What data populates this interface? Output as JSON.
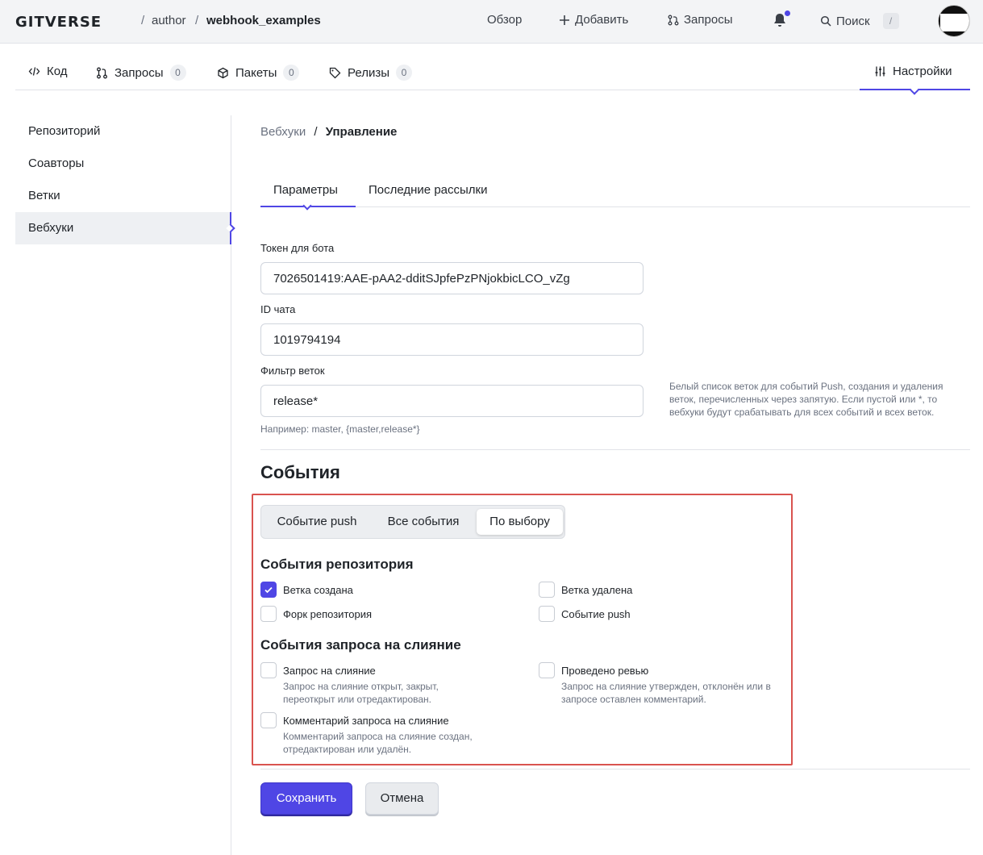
{
  "header": {
    "logo": "GITVERSE",
    "sep1": "/",
    "owner": "author",
    "sep2": "/",
    "repo": "webhook_examples",
    "nav": {
      "overview": "Обзор",
      "add": "Добавить",
      "requests": "Запросы",
      "search": "Поиск",
      "search_key": "/"
    }
  },
  "repo_tabs": [
    {
      "label": "Код"
    },
    {
      "label": "Запросы",
      "count": "0"
    },
    {
      "label": "Пакеты",
      "count": "0"
    },
    {
      "label": "Релизы",
      "count": "0"
    }
  ],
  "settings_tab": "Настройки",
  "sidebar": {
    "items": [
      {
        "label": "Репозиторий"
      },
      {
        "label": "Соавторы"
      },
      {
        "label": "Ветки"
      },
      {
        "label": "Вебхуки"
      }
    ]
  },
  "breadcrumb": {
    "parent": "Вебхуки",
    "sep": "/",
    "current": "Управление"
  },
  "subtabs": {
    "params": "Параметры",
    "deliveries": "Последние рассылки"
  },
  "form": {
    "token_label": "Токен для бота",
    "token_value": "7026501419:AAE-pAA2-dditSJpfePzPNjokbicLCO_vZg",
    "chat_label": "ID чата",
    "chat_value": "1019794194",
    "branch_label": "Фильтр веток",
    "branch_value": "release*",
    "branch_hint": "Например: master, {master,release*}",
    "branch_help": "Белый список веток для событий Push, создания и удаления веток, перечисленных через запятую. Если пустой или *, то вебхуки будут срабатывать для всех событий и всех веток."
  },
  "events": {
    "title": "События",
    "modes": {
      "push": "Событие push",
      "all": "Все события",
      "custom": "По выбору"
    },
    "repo_group": {
      "title": "События репозитория",
      "branch_created": {
        "label": "Ветка создана",
        "checked": true
      },
      "branch_deleted": {
        "label": "Ветка удалена",
        "checked": false
      },
      "fork": {
        "label": "Форк репозитория",
        "checked": false
      },
      "push": {
        "label": "Событие push",
        "checked": false
      }
    },
    "pr_group": {
      "title": "События запроса на слияние",
      "pr": {
        "label": "Запрос на слияние",
        "desc": "Запрос на слияние открыт, закрыт, переоткрыт или отредактирован.",
        "checked": false
      },
      "review": {
        "label": "Проведено ревью",
        "desc": "Запрос на слияние утвержден, отклонён или в запросе оставлен комментарий.",
        "checked": false
      },
      "comment": {
        "label": "Комментарий запроса на слияние",
        "desc": "Комментарий запроса на слияние создан, отредактирован или удалён.",
        "checked": false
      }
    }
  },
  "actions": {
    "save": "Сохранить",
    "cancel": "Отмена"
  },
  "colors": {
    "accent": "#4f46e5",
    "highlight_box": "#d9534f"
  }
}
